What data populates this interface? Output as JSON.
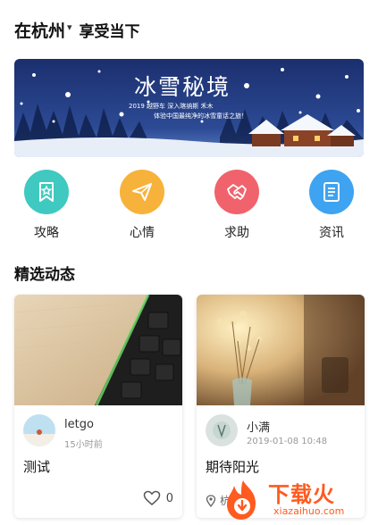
{
  "header": {
    "city": "在杭州",
    "tagline": "享受当下"
  },
  "banner": {
    "title": "冰雪秘境",
    "line1": "2019 越野车 深入喀纳斯 禾木",
    "line2": "体验中国最纯净的冰雪童话之旅！"
  },
  "categories": [
    {
      "label": "攻略",
      "icon": "bookmark-star-icon",
      "color": "#3fc9c0"
    },
    {
      "label": "心情",
      "icon": "paper-plane-icon",
      "color": "#f7b23b"
    },
    {
      "label": "求助",
      "icon": "handshake-icon",
      "color": "#f0636d"
    },
    {
      "label": "资讯",
      "icon": "document-list-icon",
      "color": "#3ea3f0"
    }
  ],
  "section": {
    "title": "精选动态"
  },
  "posts": [
    {
      "username": "letgo",
      "time": "15小时前",
      "title": "测试",
      "likes": "0"
    },
    {
      "username": "小满",
      "time": "2019-01-08 10:48",
      "title": "期待阳光",
      "location": "杭"
    }
  ],
  "watermark": {
    "cn": "下载火",
    "en": "xiazaihuo.com",
    "color": "#ff5a1f"
  }
}
